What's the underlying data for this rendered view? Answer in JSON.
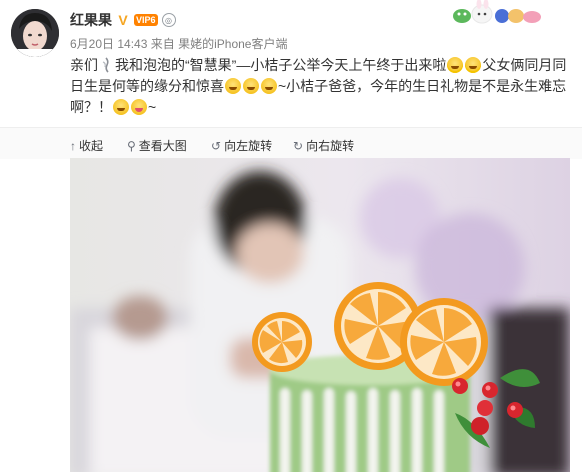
{
  "author": {
    "name": "红果果",
    "verified_icon": "verified-v-icon",
    "vip_label": "6"
  },
  "meta": {
    "time": "6月20日 14:43",
    "source_prefix": "来自",
    "source": "果姥的iPhone客户端"
  },
  "post": {
    "segment1": "亲们",
    "segment2": "我和泡泡的",
    "segment3": "“智慧果”",
    "segment4": "—小桔子公举今天上午终于出来啦",
    "segment5": "父女俩同月同日生是何等的缘分和惊喜",
    "segment6": "~小桔子爸爸，今年的生日礼物是不是永生难忘啊？！",
    "segment7": "~"
  },
  "toolbar": {
    "collapse": "收起",
    "view_large": "查看大图",
    "rotate_left": "向左旋转",
    "rotate_right": "向右旋转"
  },
  "colors": {
    "accent": "#ff8200",
    "link": "#eb7350",
    "meta": "#808080"
  }
}
